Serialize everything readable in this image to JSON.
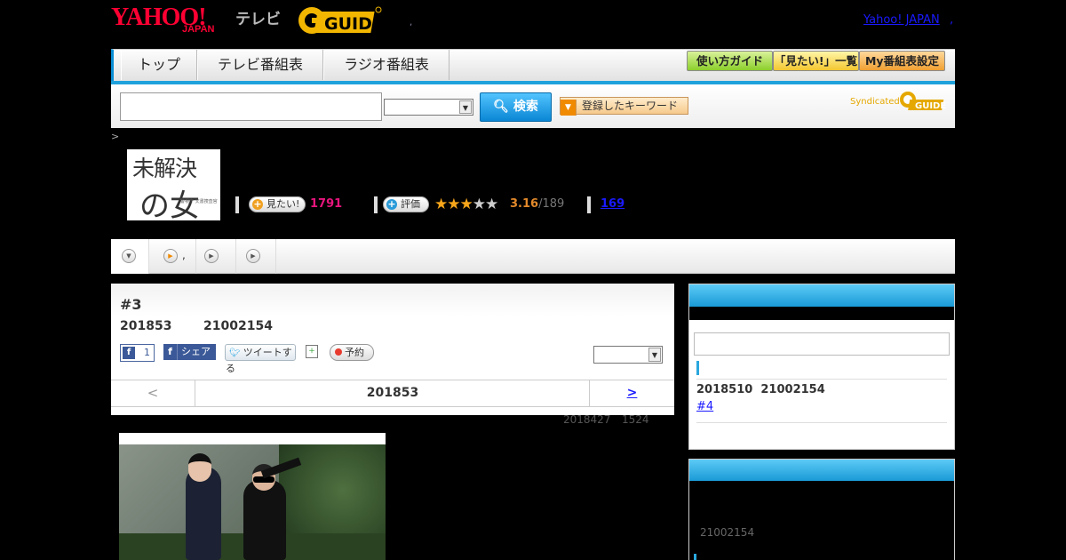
{
  "header": {
    "yahoo_logo": "YAHOO!",
    "japan_logo": "JAPAN",
    "tv_label": "テレビ",
    "gguide_logo": "G-GUIDE",
    "dot": ",",
    "yahoo_japan_link": "Yahoo! JAPAN",
    "trailing_dot": ","
  },
  "nav": {
    "tabs": [
      "トップ",
      "テレビ番組表",
      "ラジオ番組表"
    ],
    "guide_button": "使い方ガイド",
    "wishlist_button": "「見たい!」一覧",
    "my_schedule_button": "My番組表設定",
    "colors": {
      "accent": "#1fa1dc"
    }
  },
  "search": {
    "input_value": "",
    "select_value": "",
    "search_button": "検索",
    "keyword_button": "登録したキーワード",
    "syndicated_label": "Syndicated",
    "syndicated_logo": "GUIDE"
  },
  "breadcrumb": ">",
  "program": {
    "poster_line1": "未解決",
    "poster_line2": "の女",
    "poster_sub": "警視庁\n文書捜査官",
    "want_label": "見たい!",
    "want_count": "1791",
    "rating_label": "評価",
    "rating_stars": 3,
    "rating_value": "3.16",
    "rating_total": "/189",
    "review_count": "169"
  },
  "tabs": {
    "items": [
      "",
      ",",
      "",
      ""
    ]
  },
  "episode": {
    "title": "#3",
    "date": "201853",
    "time": "21002154",
    "fb_like_count": "1",
    "fb_share_label": "シェア",
    "tweet_label": "ツイートする",
    "reserve_label": "予約",
    "select_value": "",
    "prev": "<",
    "current": "201853",
    "next": ">"
  },
  "update_note": {
    "date": "2018427",
    "time": "1524"
  },
  "sidebar": {
    "upcoming_date": "2018510",
    "upcoming_time": "21002154",
    "upcoming_link": "#4",
    "second_time": "21002154"
  }
}
